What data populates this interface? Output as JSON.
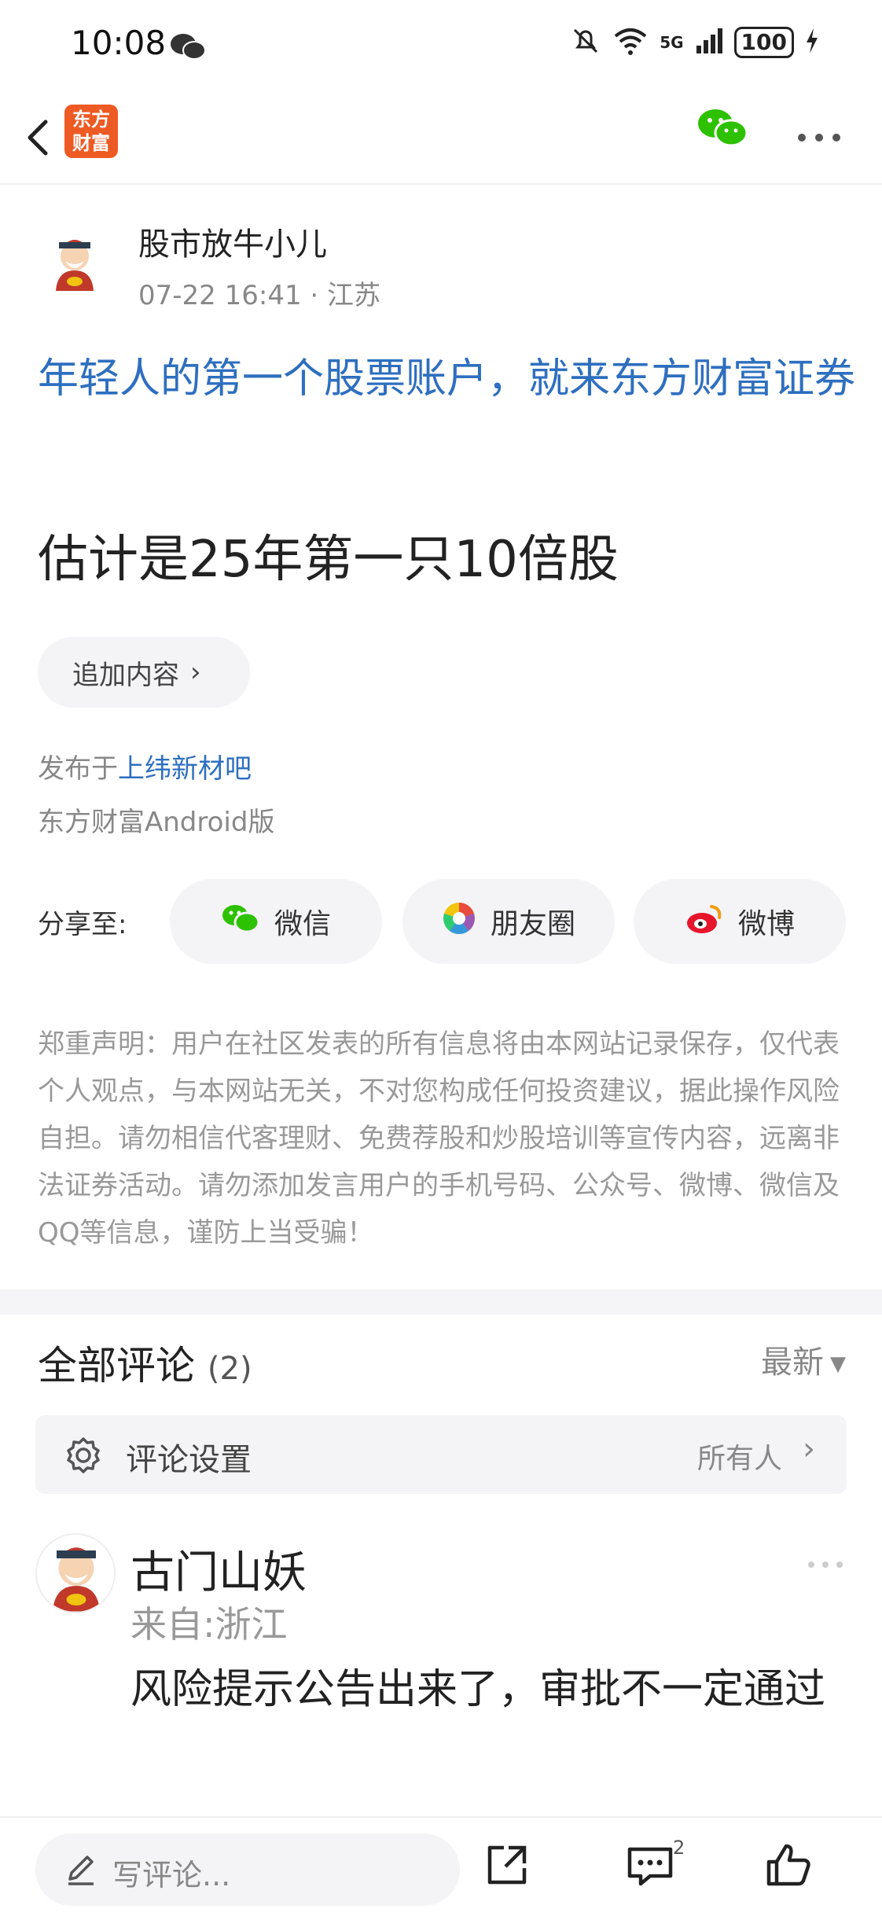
{
  "status_bar": {
    "time": "10:08",
    "battery": "100",
    "network": "5G",
    "wifi_label": "6"
  },
  "header": {
    "logo_text_line1": "东方",
    "logo_text_line2": "财富"
  },
  "post": {
    "author": "股市放牛小儿",
    "meta": "07-22 16:41 · 江苏",
    "promo": "年轻人的第一个股票账户，就来东方财富证券",
    "title": "估计是25年第一只10倍股",
    "add_content_label": "追加内容",
    "published_prefix": "发布于",
    "published_forum": "上纬新材吧",
    "client": "东方财富Android版"
  },
  "share": {
    "label": "分享至:",
    "buttons": [
      "微信",
      "朋友圈",
      "微博"
    ]
  },
  "disclaimer": "郑重声明：用户在社区发表的所有信息将由本网站记录保存，仅代表个人观点，与本网站无关，不对您构成任何投资建议，据此操作风险自担。请勿相信代客理财、免费荐股和炒股培训等宣传内容，远离非法证券活动。请勿添加发言用户的手机号码、公众号、微博、微信及QQ等信息，谨防上当受骗！",
  "comments": {
    "title": "全部评论",
    "count": "(2)",
    "sort": "最新",
    "settings_label": "评论设置",
    "settings_value": "所有人",
    "items": [
      {
        "name": "古门山妖",
        "location": "来自:浙江",
        "text": "风险提示公告出来了，审批不一定通过"
      }
    ]
  },
  "bottom_bar": {
    "placeholder": "写评论...",
    "comment_count": "2"
  },
  "colors": {
    "link_blue": "#2e6fbf",
    "wechat_green": "#2dc100",
    "brand_orange": "#ee5a24"
  }
}
